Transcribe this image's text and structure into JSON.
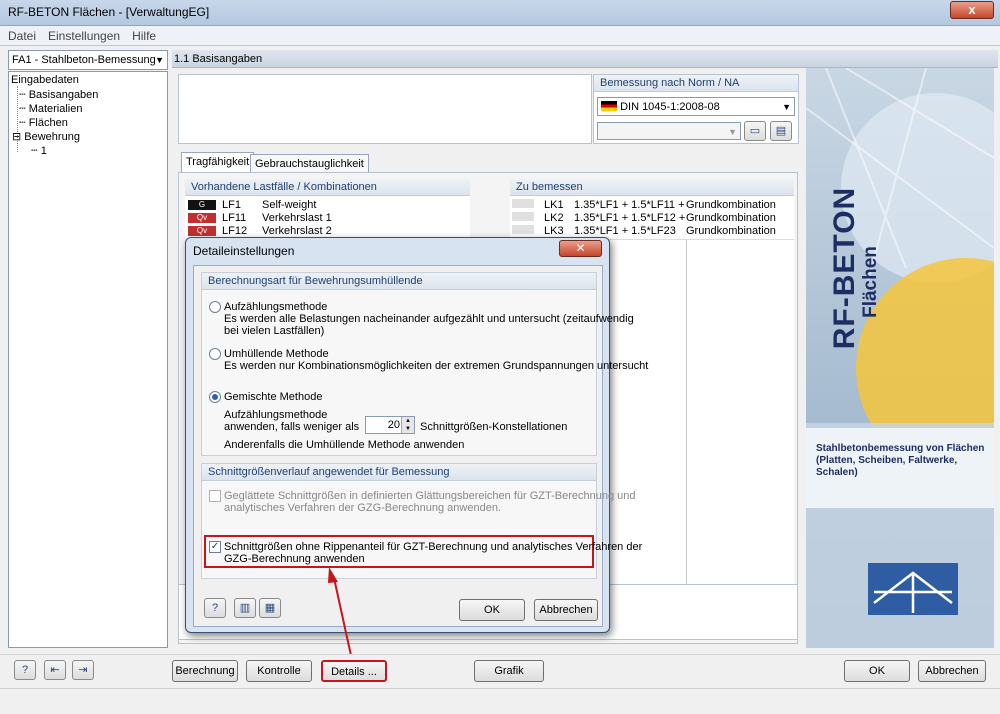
{
  "window": {
    "title": "RF-BETON Flächen - [VerwaltungEG]",
    "close_glyph": "x"
  },
  "menu": [
    "Datei",
    "Einstellungen",
    "Hilfe"
  ],
  "case_select": "FA1 - Stahlbeton-Bemessung",
  "tree": {
    "root": "Eingabedaten",
    "items": [
      "Basisangaben",
      "Materialien",
      "Flächen",
      "Bewehrung",
      "1"
    ]
  },
  "section_header": "1.1 Basisangaben",
  "norm": {
    "label": "Bemessung nach Norm / NA",
    "value": "DIN 1045-1:2008-08"
  },
  "tabs": [
    "Tragfähigkeit",
    "Gebrauchstauglichkeit"
  ],
  "loadcases": {
    "header": "Vorhandene Lastfälle / Kombinationen",
    "rows": [
      {
        "badge": "G",
        "badge_color": "#111111",
        "id": "LF1",
        "name": "Self-weight"
      },
      {
        "badge": "Qv",
        "badge_color": "#c03030",
        "id": "LF11",
        "name": "Verkehrslast 1"
      },
      {
        "badge": "Qv",
        "badge_color": "#c03030",
        "id": "LF12",
        "name": "Verkehrslast 2"
      }
    ]
  },
  "design": {
    "header": "Zu bemessen",
    "rows": [
      {
        "id": "LK1",
        "formula": "1.35*LF1 + 1.5*LF11 +",
        "type": "Grundkombination"
      },
      {
        "id": "LK2",
        "formula": "1.35*LF1 + 1.5*LF12 +",
        "type": "Grundkombination"
      },
      {
        "id": "LK3",
        "formula": "1.35*LF1 + 1.5*LF23",
        "type": "Grundkombination"
      }
    ]
  },
  "brand": {
    "title": "RF-BETON",
    "subtitle": "Flächen",
    "description": "Stahlbetonbemessung von Flächen (Platten, Scheiben, Faltwerke, Schalen)"
  },
  "dialog": {
    "title": "Detaileinstellungen",
    "group1": {
      "header": "Berechnungsart für Bewehrungsumhüllende",
      "opt1_title": "Aufzählungsmethode",
      "opt1_desc1": "Es werden alle Belastungen nacheinander aufgezählt und untersucht (zeitaufwendig",
      "opt1_desc2": "bei vielen Lastfällen)",
      "opt2_title": "Umhüllende Methode",
      "opt2_desc": "Es werden nur Kombinationsmöglichkeiten der extremen Grundspannungen untersucht",
      "opt3_title": "Gemischte Methode",
      "opt3_line1": "Aufzählungsmethode",
      "opt3_line2": "anwenden, falls weniger als",
      "spinner_value": "20",
      "spinner_suffix": "Schnittgrößen-Konstellationen",
      "opt3_line3": "Anderenfalls die Umhüllende Methode anwenden"
    },
    "group2": {
      "header": "Schnittgrößenverlauf angewendet für Bemessung",
      "check1_line1": "Geglättete Schnittgrößen in definierten Glättungsbereichen für GZT-Berechnung und",
      "check1_line2": "analytisches Verfahren der GZG-Berechnung anwenden.",
      "check2_line1": "Schnittgrößen ohne Rippenanteil für GZT-Berechnung und analytisches Verfahren der",
      "check2_line2": "GZG-Berechnung anwenden"
    },
    "ok": "OK",
    "cancel": "Abbrechen"
  },
  "bottom": {
    "calc": "Berechnung",
    "check": "Kontrolle",
    "details": "Details ...",
    "graphic": "Grafik",
    "ok": "OK",
    "cancel": "Abbrechen"
  },
  "colors": {
    "highlight": "#c4161c",
    "accent": "#1f3f70"
  }
}
